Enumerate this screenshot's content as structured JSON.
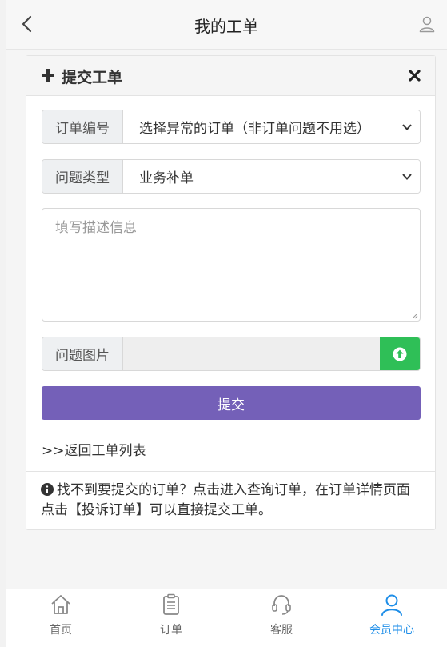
{
  "header": {
    "title": "我的工单"
  },
  "form": {
    "title": "提交工单",
    "order_label": "订单编号",
    "order_value": "选择异常的订单（非订单问题不用选）",
    "type_label": "问题类型",
    "type_value": "业务补单",
    "description_placeholder": "填写描述信息",
    "image_label": "问题图片",
    "submit_label": "提交",
    "back_link": ">>返回工单列表",
    "tip": "找不到要提交的订单？点击进入查询订单，在订单详情页面点击【投诉订单】可以直接提交工单。"
  },
  "tabs": [
    {
      "label": "首页",
      "icon": "home-icon"
    },
    {
      "label": "订单",
      "icon": "clipboard-icon"
    },
    {
      "label": "客服",
      "icon": "headset-icon"
    },
    {
      "label": "会员中心",
      "icon": "user-icon",
      "active": true
    }
  ],
  "colors": {
    "accent": "#7460b8",
    "upload": "#2fbf57",
    "active_tab": "#1e8ee8"
  }
}
